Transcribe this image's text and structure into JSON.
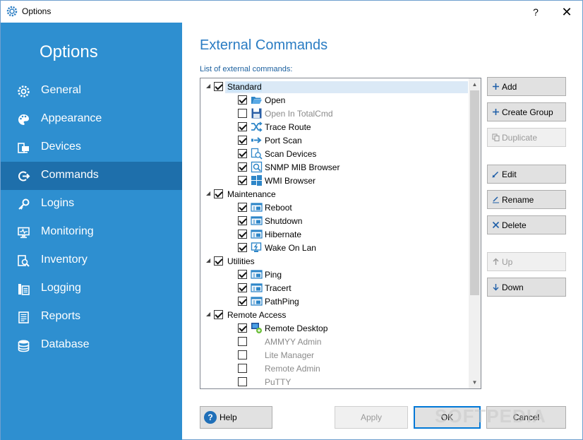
{
  "window": {
    "title": "Options",
    "help_glyph": "?",
    "close_glyph": "✕"
  },
  "sidebar": {
    "title": "Options",
    "items": [
      {
        "label": "General",
        "icon": "gear-icon"
      },
      {
        "label": "Appearance",
        "icon": "palette-icon"
      },
      {
        "label": "Devices",
        "icon": "devices-icon"
      },
      {
        "label": "Commands",
        "icon": "commands-icon",
        "active": true
      },
      {
        "label": "Logins",
        "icon": "key-icon"
      },
      {
        "label": "Monitoring",
        "icon": "monitor-icon"
      },
      {
        "label": "Inventory",
        "icon": "inventory-icon"
      },
      {
        "label": "Logging",
        "icon": "logging-icon"
      },
      {
        "label": "Reports",
        "icon": "reports-icon"
      },
      {
        "label": "Database",
        "icon": "database-icon"
      }
    ]
  },
  "main": {
    "title": "External Commands",
    "list_label": "List of external commands:"
  },
  "tree": [
    {
      "label": "Standard",
      "level": 0,
      "checked": true,
      "group": true,
      "selected": true
    },
    {
      "label": "Open",
      "level": 1,
      "checked": true,
      "icon": "folder-open-icon"
    },
    {
      "label": "Open In TotalCmd",
      "level": 1,
      "checked": false,
      "disabled": true,
      "icon": "floppy-icon"
    },
    {
      "label": "Trace Route",
      "level": 1,
      "checked": true,
      "icon": "shuffle-icon"
    },
    {
      "label": "Port Scan",
      "level": 1,
      "checked": true,
      "icon": "arrow-right-icon"
    },
    {
      "label": "Scan Devices",
      "level": 1,
      "checked": true,
      "icon": "scan-devices-icon"
    },
    {
      "label": "SNMP MIB Browser",
      "level": 1,
      "checked": true,
      "icon": "magnifier-icon"
    },
    {
      "label": "WMI Browser",
      "level": 1,
      "checked": true,
      "icon": "windows-icon"
    },
    {
      "label": "Maintenance",
      "level": 0,
      "checked": true,
      "group": true
    },
    {
      "label": "Reboot",
      "level": 1,
      "checked": true,
      "icon": "console-icon"
    },
    {
      "label": "Shutdown",
      "level": 1,
      "checked": true,
      "icon": "console-icon"
    },
    {
      "label": "Hibernate",
      "level": 1,
      "checked": true,
      "icon": "console-icon"
    },
    {
      "label": "Wake On Lan",
      "level": 1,
      "checked": true,
      "icon": "wake-icon"
    },
    {
      "label": "Utilities",
      "level": 0,
      "checked": true,
      "group": true
    },
    {
      "label": "Ping",
      "level": 1,
      "checked": true,
      "icon": "console-icon"
    },
    {
      "label": "Tracert",
      "level": 1,
      "checked": true,
      "icon": "console-icon"
    },
    {
      "label": "PathPing",
      "level": 1,
      "checked": true,
      "icon": "console-icon"
    },
    {
      "label": "Remote Access",
      "level": 0,
      "checked": true,
      "group": true
    },
    {
      "label": "Remote Desktop",
      "level": 1,
      "checked": true,
      "icon": "remote-desktop-icon"
    },
    {
      "label": "AMMYY Admin",
      "level": 1,
      "checked": false,
      "disabled": true
    },
    {
      "label": "Lite Manager",
      "level": 1,
      "checked": false,
      "disabled": true
    },
    {
      "label": "Remote Admin",
      "level": 1,
      "checked": false,
      "disabled": true
    },
    {
      "label": "PuTTY",
      "level": 1,
      "checked": false,
      "disabled": true
    }
  ],
  "side_buttons": [
    {
      "label": "Add",
      "icon": "plus-icon",
      "disabled": false
    },
    {
      "label": "Create Group",
      "icon": "plus-icon",
      "disabled": false
    },
    {
      "label": "Duplicate",
      "icon": "copy-icon",
      "disabled": true
    },
    {
      "label": "Edit",
      "icon": "pencil-icon",
      "disabled": false
    },
    {
      "label": "Rename",
      "icon": "rename-icon",
      "disabled": false
    },
    {
      "label": "Delete",
      "icon": "cross-icon",
      "disabled": false
    },
    {
      "label": "Up",
      "icon": "arrow-up-icon",
      "disabled": true
    },
    {
      "label": "Down",
      "icon": "arrow-down-icon",
      "disabled": false
    }
  ],
  "footer": {
    "help_label": "Help",
    "help_glyph": "?",
    "apply_label": "Apply",
    "ok_label": "OK",
    "cancel_label": "Cancel"
  },
  "watermark": "SOFTPEDIA",
  "colors": {
    "sidebar_bg": "#2e8fd0",
    "sidebar_active": "#1e6fab",
    "accent": "#2a7cc3"
  }
}
